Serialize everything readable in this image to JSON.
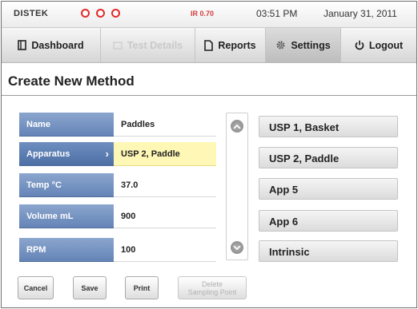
{
  "status": {
    "logo": "DISTEK",
    "ir_reading": "IR 0.70",
    "time": "03:51 PM",
    "date": "January 31, 2011",
    "indicator_color": "#e12a2a"
  },
  "nav": {
    "dashboard": "Dashboard",
    "test_details": "Test Details",
    "reports": "Reports",
    "settings": "Settings",
    "logout": "Logout"
  },
  "page": {
    "title": "Create New Method"
  },
  "params": {
    "rows": [
      {
        "label": "Name",
        "value": "Paddles"
      },
      {
        "label": "Apparatus",
        "value": "USP 2, Paddle",
        "selected": true
      },
      {
        "label": "Temp °C",
        "value": "37.0"
      },
      {
        "label": "Volume mL",
        "value": "900"
      },
      {
        "label": "RPM",
        "value": "100"
      }
    ]
  },
  "apparatus_options": [
    "USP 1, Basket",
    "USP 2, Paddle",
    "App 5",
    "App 6",
    "Intrinsic"
  ],
  "actions": {
    "cancel": "Cancel",
    "save": "Save",
    "print": "Print",
    "delete_line1": "Delete",
    "delete_line2": "Sampling Point"
  },
  "colors": {
    "label_bg": "#7594c3",
    "selected_value_bg": "#fff7b5"
  }
}
